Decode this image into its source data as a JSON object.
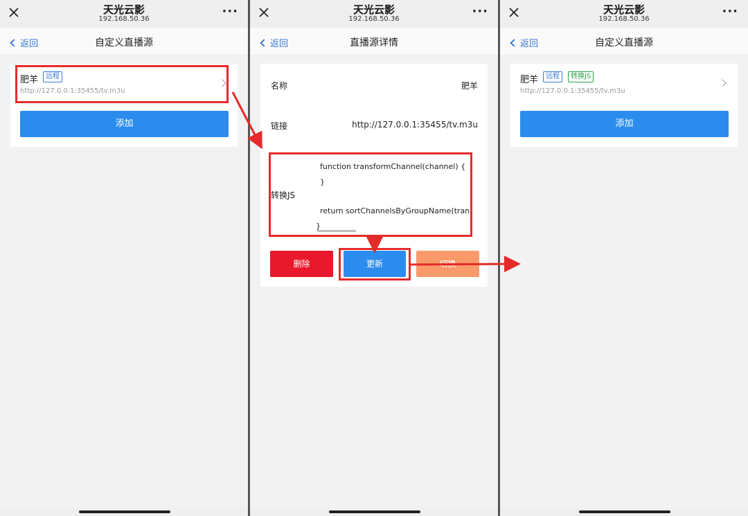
{
  "app": {
    "title": "天光云影",
    "ip": "192.168.50.36",
    "more_label": "···"
  },
  "panel1": {
    "back_label": "返回",
    "nav_title": "自定义直播源",
    "item": {
      "name": "肥羊",
      "tag": "远程",
      "url": "http://127.0.0.1:35455/tv.m3u"
    },
    "add_label": "添加"
  },
  "panel2": {
    "back_label": "返回",
    "nav_title": "直播源详情",
    "name_label": "名称",
    "name_value": "肥羊",
    "link_label": "链接",
    "link_value": "http://127.0.0.1:35455/tv.m3u",
    "js_label": "转换JS",
    "js_lines": [
      "function transformChannel(channel) {",
      "}",
      "return sortChannelsByGroupName(tran",
      "}"
    ],
    "delete_label": "删除",
    "update_label": "更新",
    "switch_label": "切换"
  },
  "panel3": {
    "back_label": "返回",
    "nav_title": "自定义直播源",
    "item": {
      "name": "肥羊",
      "tag1": "远程",
      "tag2": "转换JS",
      "url": "http://127.0.0.1:35455/tv.m3u"
    },
    "add_label": "添加"
  },
  "colors": {
    "primary": "#2b8cee",
    "danger": "#e8192c",
    "warning": "#fa9a6b",
    "annotation": "#e52a2a"
  }
}
